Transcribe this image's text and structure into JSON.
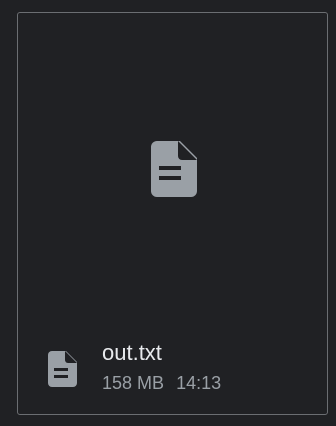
{
  "file": {
    "name": "out.txt",
    "size": "158 MB",
    "time": "14:13",
    "icon": "text-file-icon"
  },
  "colors": {
    "background": "#202124",
    "card_border": "#6b6e72",
    "icon": "#9aa0a6",
    "name_text": "#e8eaed",
    "meta_text": "#9aa0a6"
  }
}
